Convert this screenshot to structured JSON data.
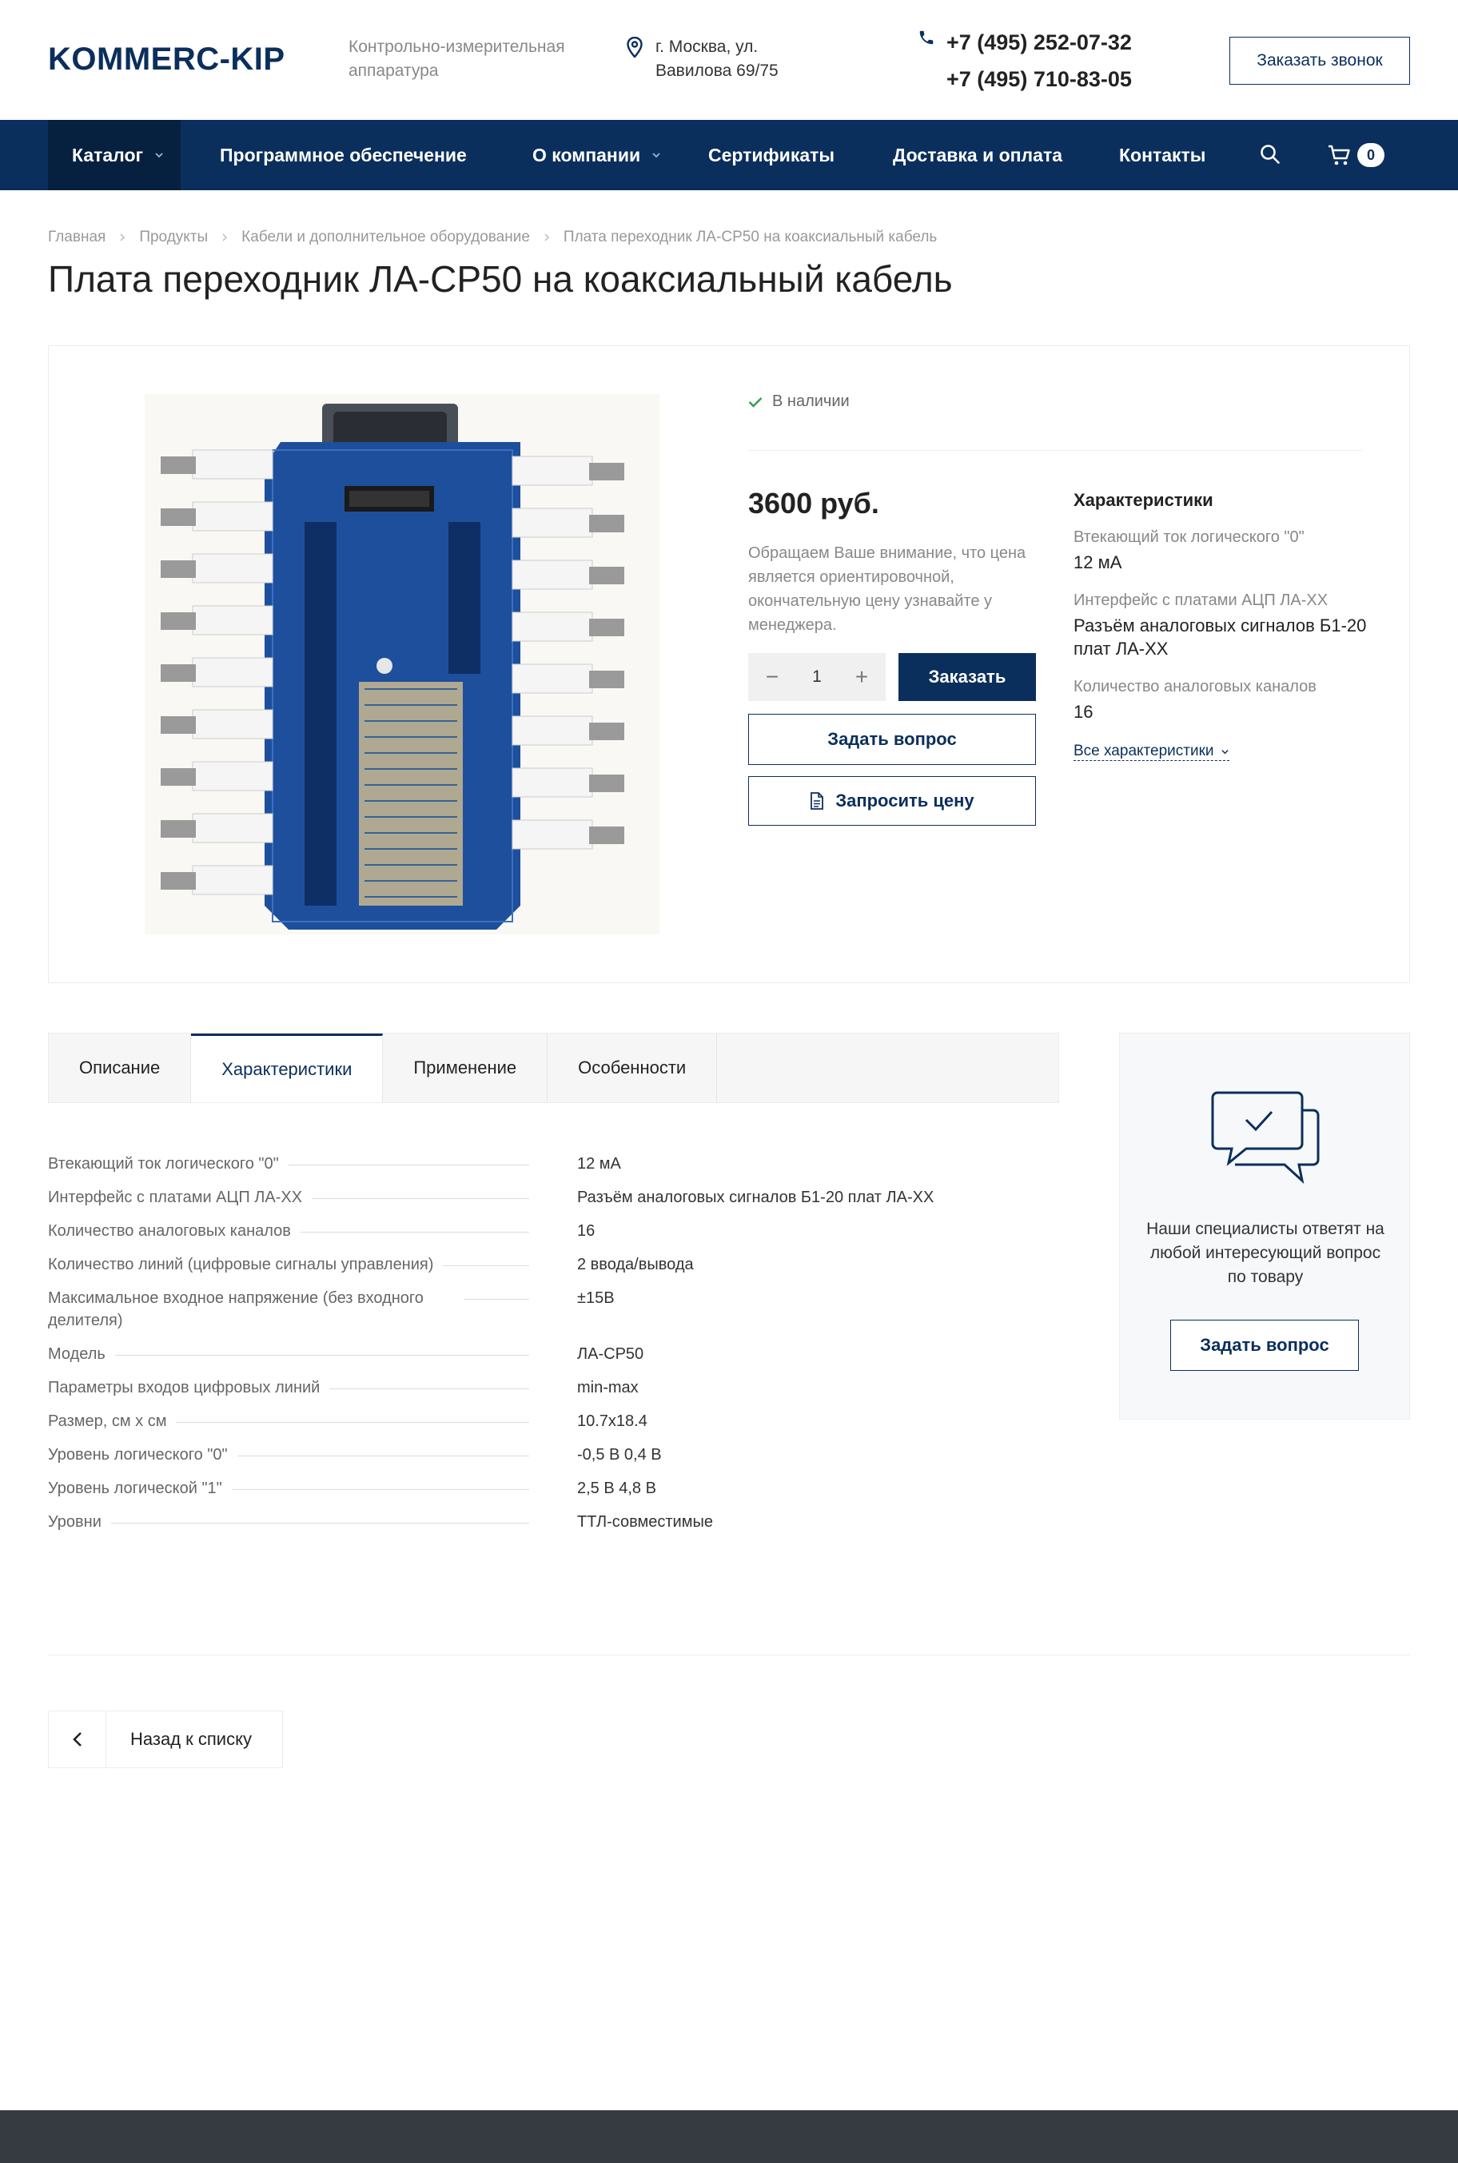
{
  "header": {
    "logo": "KOMMERC-KIP",
    "tagline": "Контрольно-измерительная аппаратура",
    "address": "г. Москва, ул. Вавилова 69/75",
    "phone1": "+7 (495) 252-07-32",
    "phone2": "+7 (495) 710-83-05",
    "callback_label": "Заказать звонок"
  },
  "nav": {
    "items": [
      "Каталог",
      "Программное обеспечение",
      "О компании",
      "Сертификаты",
      "Доставка и оплата",
      "Контакты"
    ],
    "cart_count": "0"
  },
  "breadcrumb": [
    "Главная",
    "Продукты",
    "Кабели и дополнительное оборудование",
    "Плата переходник ЛА-СР50 на коаксиальный кабель"
  ],
  "product": {
    "title": "Плата переходник ЛА-СР50 на коаксиальный кабель",
    "stock": "В наличии",
    "price": "3600 руб.",
    "price_note": "Обращаем Ваше внимание, что цена является ориентировочной, окончательную цену узнавайте у менеджера.",
    "quantity": "1",
    "order_label": "Заказать",
    "ask_label": "Задать вопрос",
    "request_price_label": "Запросить цену",
    "specs_title": "Характеристики",
    "short_specs": [
      {
        "name": "Втекающий ток логического \"0\"",
        "value": "12 мА"
      },
      {
        "name": "Интерфейс с платами АЦП ЛА-XX",
        "value": "Разъём аналоговых сигналов Б1-20 плат ЛА-XX"
      },
      {
        "name": "Количество аналоговых каналов",
        "value": "16"
      }
    ],
    "all_specs_label": "Все характеристики"
  },
  "tabs": [
    "Описание",
    "Характеристики",
    "Применение",
    "Особенности"
  ],
  "specs": [
    {
      "name": "Втекающий ток логического \"0\"",
      "value": "12 мА"
    },
    {
      "name": "Интерфейс с платами АЦП ЛА-XX",
      "value": "Разъём аналоговых сигналов Б1-20 плат ЛА-XX"
    },
    {
      "name": "Количество аналоговых каналов",
      "value": "16"
    },
    {
      "name": "Количество линий (цифровые сигналы управления)",
      "value": "2 ввода/вывода"
    },
    {
      "name": "Максимальное входное напряжение (без входного делителя)",
      "value": "±15В"
    },
    {
      "name": "Модель",
      "value": "ЛА-СР50"
    },
    {
      "name": "Параметры входов цифровых линий",
      "value": "min-max"
    },
    {
      "name": "Размер, см х см",
      "value": "10.7x18.4"
    },
    {
      "name": "Уровень логического \"0\"",
      "value": "-0,5 В 0,4 В"
    },
    {
      "name": "Уровень логической \"1\"",
      "value": "2,5 В 4,8 В"
    },
    {
      "name": "Уровни",
      "value": "ТТЛ-совместимые"
    }
  ],
  "side": {
    "text": "Наши специалисты ответят на любой интересующий вопрос по товару",
    "ask_label": "Задать вопрос"
  },
  "back_label": "Назад к списку",
  "colors": {
    "primary": "#0b2f5c",
    "footer": "#363b42",
    "stock_check": "#2e9e4f"
  }
}
